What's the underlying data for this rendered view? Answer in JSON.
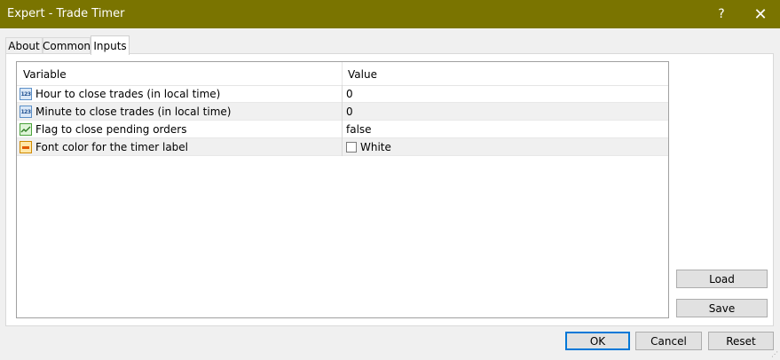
{
  "window": {
    "title": "Expert - Trade Timer",
    "help_label": "?",
    "close_label": "✕"
  },
  "tabs": [
    {
      "label": "About"
    },
    {
      "label": "Common"
    },
    {
      "label": "Inputs",
      "active": true
    }
  ],
  "table": {
    "headers": {
      "variable": "Variable",
      "value": "Value"
    },
    "rows": [
      {
        "icon": "number-param-icon",
        "icon_text": "123",
        "variable": "Hour to close trades (in local time)",
        "value": "0"
      },
      {
        "icon": "number-param-icon",
        "icon_text": "123",
        "variable": "Minute to close trades (in local time)",
        "value": "0"
      },
      {
        "icon": "boolean-param-icon",
        "variable": "Flag to close pending orders",
        "value": "false"
      },
      {
        "icon": "color-param-icon",
        "variable": "Font color for the timer label",
        "value": "White"
      }
    ]
  },
  "side_buttons": {
    "load": "Load",
    "save": "Save"
  },
  "footer_buttons": {
    "ok": "OK",
    "cancel": "Cancel",
    "reset": "Reset"
  },
  "colors": {
    "titlebar": "#7a7400",
    "focus_border": "#0078d7"
  }
}
